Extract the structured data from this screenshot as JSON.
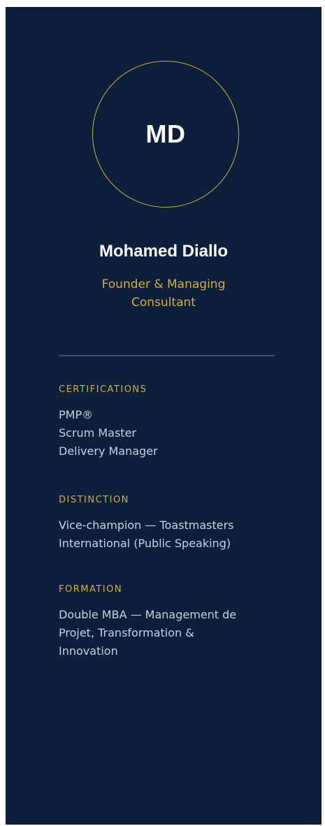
{
  "profile": {
    "initials": "MD",
    "name": "Mohamed Diallo",
    "role_line1": "Founder & Managing",
    "role_line2": "Consultant"
  },
  "certifications": {
    "title": "CERTIFICATIONS",
    "items": [
      "PMP®",
      "Scrum Master",
      "Delivery Manager"
    ]
  },
  "distinction": {
    "title": "DISTINCTION",
    "lines": [
      "Vice-champion — Toastmasters",
      "International (Public Speaking)"
    ]
  },
  "formation": {
    "title": "FORMATION",
    "lines": [
      "Double MBA — Management de",
      "Projet, Transformation &",
      "Innovation"
    ]
  },
  "colors": {
    "background": "#0c1f3b",
    "accent": "#d4af37",
    "text": "#c9d1de",
    "divider": "#3d4c66"
  }
}
